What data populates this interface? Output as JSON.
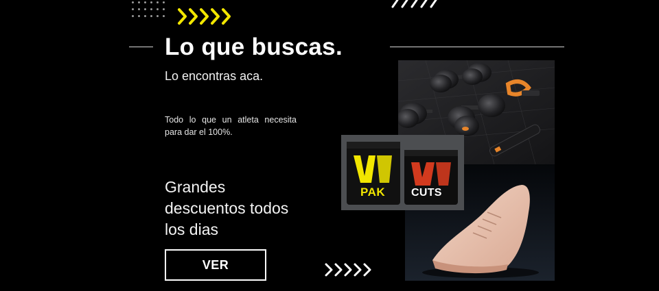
{
  "hero": {
    "headline": "Lo que buscas.",
    "subheadline": "Lo encontras aca.",
    "tagline": "Todo lo que un atleta necesita para dar el 100%.",
    "promo": "Grandes descuentos todos los dias",
    "cta_label": "VER"
  },
  "products": {
    "supplement_1_label": "PAK",
    "supplement_2_label": "CUTS"
  },
  "colors": {
    "background": "#000000",
    "accent_yellow": "#f2e600",
    "text": "#ffffff",
    "sneaker": "#e9c1ad",
    "dumbbell_accent": "#e8852a"
  },
  "icons": [
    "dots-grid-icon",
    "chevrons-yellow-icon",
    "chevrons-white-icon"
  ]
}
